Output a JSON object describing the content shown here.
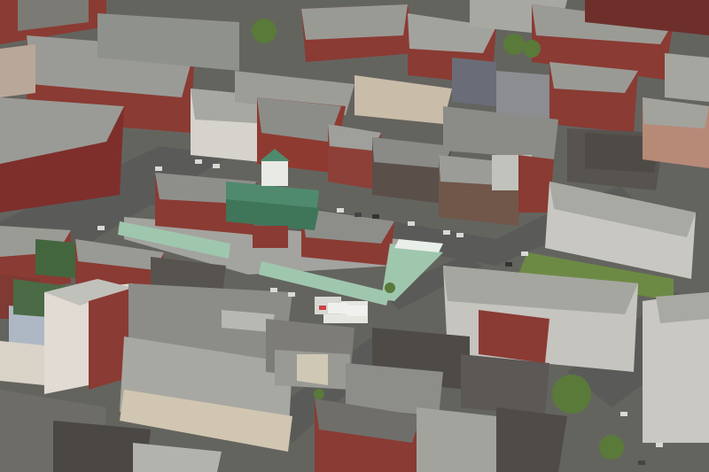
{
  "image": {
    "subject": "aerial-city-market-square",
    "palette": {
      "street": "#5f605e",
      "roof_gray": "#8f918d",
      "roof_dark": "#55534f",
      "brick": "#8a3b33",
      "brick_dark": "#6e2f2a",
      "green_roof": "#4f8a6e",
      "awning_green": "#9fc7ae",
      "awning_white": "#e9efe9",
      "grass": "#6d8a45",
      "tree": "#5a7a3a"
    }
  }
}
